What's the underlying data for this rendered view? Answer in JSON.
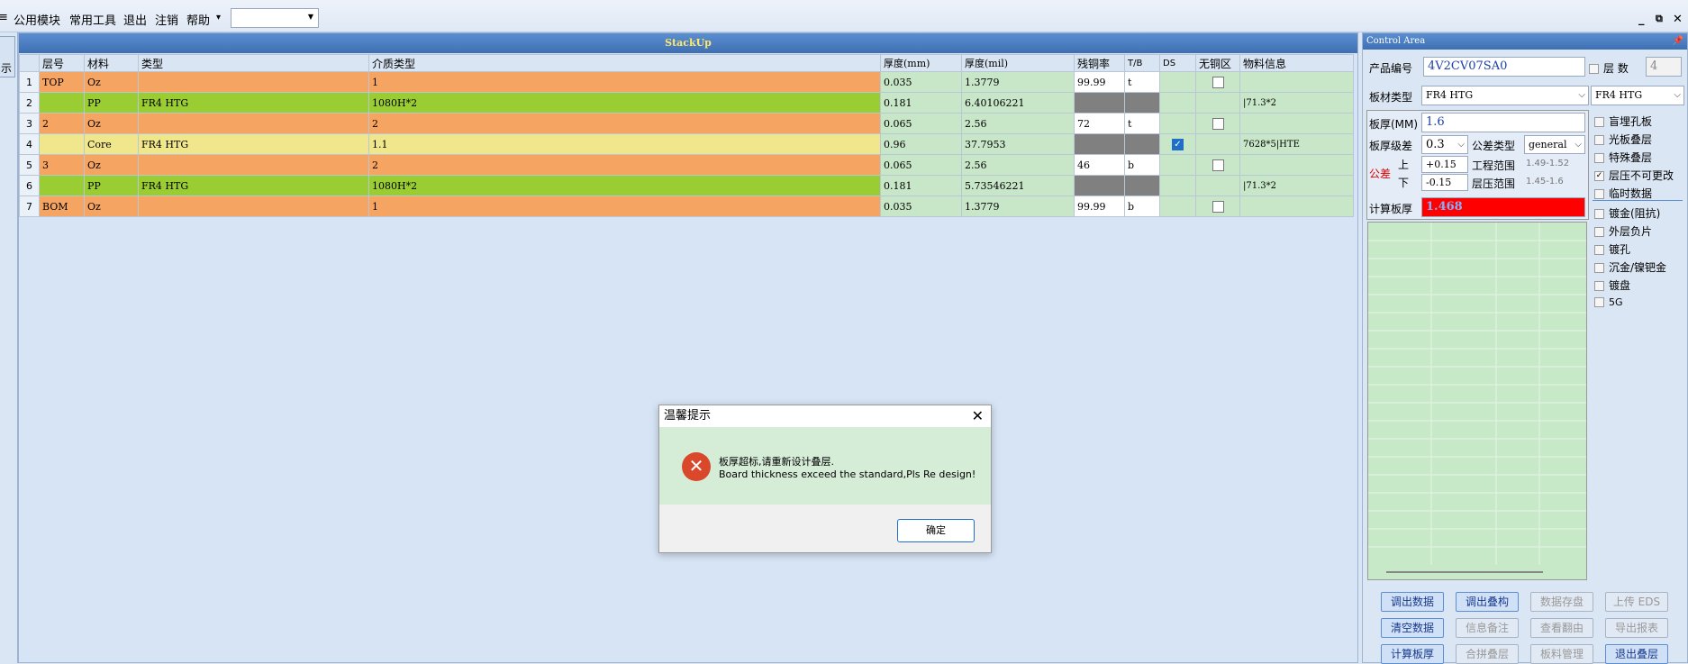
{
  "menu": {
    "items": [
      "公用模块",
      "常用工具",
      "退出",
      "注销",
      "帮助"
    ],
    "help_arrow": "▾",
    "combo_value": ""
  },
  "left_tab": "示",
  "main": {
    "title": "StackUp"
  },
  "table": {
    "headers": [
      "层号",
      "材料",
      "类型",
      "介质类型",
      "厚度(mm)",
      "厚度(mil)",
      "残铜率",
      "T/B",
      "DS",
      "无铜区",
      "物料信息"
    ],
    "rows": [
      {
        "n": "1",
        "layer": "TOP",
        "mat": "Oz",
        "type": "",
        "dielectric": "1",
        "mm": "0.035",
        "mil": "1.3779",
        "cu": "99.99",
        "tb": "t",
        "ds": "",
        "nocu": false,
        "info": "",
        "cls": "o"
      },
      {
        "n": "2",
        "layer": "",
        "mat": "PP",
        "type": "FR4 HTG",
        "dielectric": "1080H*2",
        "mm": "0.181",
        "mil": "6.40106221",
        "cu": "",
        "tb": "",
        "ds": "",
        "nocu": null,
        "info": "|71.3*2",
        "cls": "g"
      },
      {
        "n": "3",
        "layer": "2",
        "mat": "Oz",
        "type": "",
        "dielectric": "2",
        "mm": "0.065",
        "mil": "2.56",
        "cu": "72",
        "tb": "t",
        "ds": "",
        "nocu": false,
        "info": "",
        "cls": "o"
      },
      {
        "n": "4",
        "layer": "",
        "mat": "Core",
        "type": "FR4 HTG",
        "dielectric": "1.1",
        "mm": "0.96",
        "mil": "37.7953",
        "cu": "",
        "tb": "",
        "ds": "checked",
        "nocu": null,
        "info": "7628*5|HTE",
        "cls": "y"
      },
      {
        "n": "5",
        "layer": "3",
        "mat": "Oz",
        "type": "",
        "dielectric": "2",
        "mm": "0.065",
        "mil": "2.56",
        "cu": "46",
        "tb": "b",
        "ds": "",
        "nocu": false,
        "info": "",
        "cls": "o"
      },
      {
        "n": "6",
        "layer": "",
        "mat": "PP",
        "type": "FR4 HTG",
        "dielectric": "1080H*2",
        "mm": "0.181",
        "mil": "5.73546221",
        "cu": "",
        "tb": "",
        "ds": "",
        "nocu": null,
        "info": "|71.3*2",
        "cls": "g"
      },
      {
        "n": "7",
        "layer": "BOM",
        "mat": "Oz",
        "type": "",
        "dielectric": "1",
        "mm": "0.035",
        "mil": "1.3779",
        "cu": "99.99",
        "tb": "b",
        "ds": "",
        "nocu": false,
        "info": "",
        "cls": "o"
      }
    ]
  },
  "dialog": {
    "title": "温馨提示",
    "line1": "板厚超标,请重新设计叠层.",
    "line2": "Board thickness exceed the standard,Pls Re design!",
    "ok": "确定"
  },
  "control": {
    "title": "Control Area",
    "pin": "ᵖ",
    "product_label": "产品编号",
    "product_value": "4V2CV07SA0",
    "layers_label": "层 数",
    "layers_value": "4",
    "material_label": "板材类型",
    "material_value": "FR4 HTG",
    "material2_value": "FR4 HTG",
    "thickness_label": "板厚(MM)",
    "thickness_value": "1.6",
    "tol_level_label": "板厚级差",
    "tol_level_value": "0.3",
    "tol_type_label": "公差类型",
    "tol_type_value": "general",
    "tol_label": "公差",
    "upper_label": "上",
    "lower_label": "下",
    "upper_value": "+0.15",
    "lower_value": "-0.15",
    "eng_range_label": "工程范围",
    "eng_range_value": "1.49-1.52",
    "press_range_label": "层压范围",
    "press_range_value": "1.45-1.6",
    "calc_label": "计算板厚",
    "calc_value": "1.468",
    "options": [
      {
        "label": "盲埋孔板",
        "checked": false
      },
      {
        "label": "光板叠层",
        "checked": false
      },
      {
        "label": "特殊叠层",
        "checked": false
      },
      {
        "label": "层压不可更改",
        "checked": true
      },
      {
        "label": "临时数据",
        "checked": false
      },
      {
        "label": "镀金(阻抗)",
        "checked": false
      },
      {
        "label": "外层负片",
        "checked": false
      },
      {
        "label": "镀孔",
        "checked": false
      },
      {
        "label": "沉金/镍钯金",
        "checked": false
      },
      {
        "label": "镀盘",
        "checked": false
      },
      {
        "label": "5G",
        "checked": false
      }
    ],
    "buttons": [
      [
        {
          "label": "调出数据",
          "active": true
        },
        {
          "label": "调出叠构",
          "active": true
        },
        {
          "label": "数据存盘",
          "active": false
        },
        {
          "label": "上传 EDS",
          "active": false
        }
      ],
      [
        {
          "label": "清空数据",
          "active": true
        },
        {
          "label": "信息备注",
          "active": false
        },
        {
          "label": "查看翻由",
          "active": false
        },
        {
          "label": "导出报表",
          "active": false
        }
      ],
      [
        {
          "label": "计算板厚",
          "active": true
        },
        {
          "label": "合拼叠层",
          "active": false
        },
        {
          "label": "板料管理",
          "active": false
        },
        {
          "label": "退出叠层",
          "active": true
        }
      ]
    ]
  }
}
